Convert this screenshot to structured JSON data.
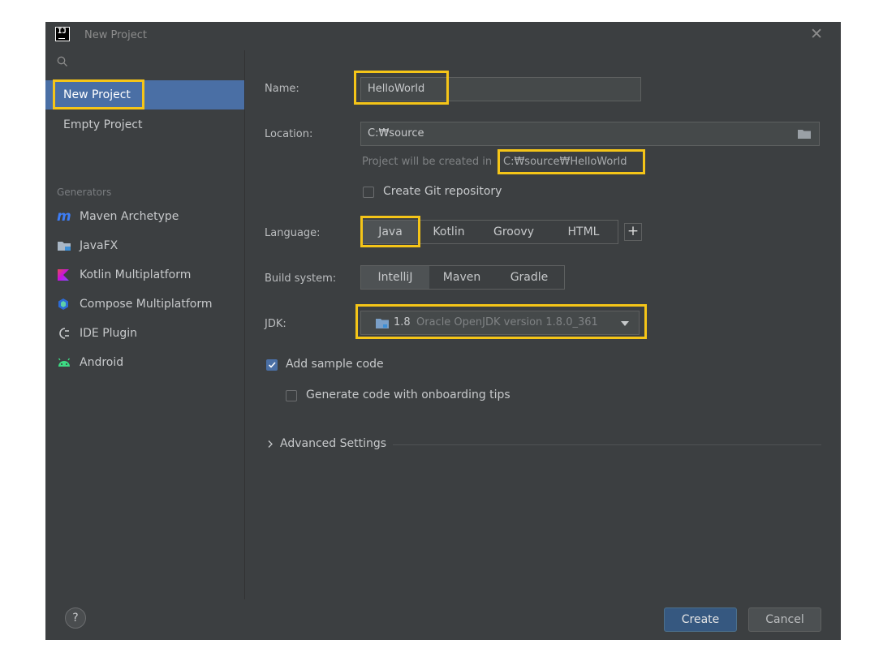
{
  "window": {
    "title": "New Project",
    "logo_text": "IJ"
  },
  "sidebar": {
    "items": [
      {
        "label": "New Project",
        "selected": true
      },
      {
        "label": "Empty Project",
        "selected": false
      }
    ],
    "group_label": "Generators",
    "generators": [
      {
        "label": "Maven Archetype",
        "icon": "maven-icon"
      },
      {
        "label": "JavaFX",
        "icon": "javafx-icon"
      },
      {
        "label": "Kotlin Multiplatform",
        "icon": "kotlin-icon"
      },
      {
        "label": "Compose Multiplatform",
        "icon": "compose-icon"
      },
      {
        "label": "IDE Plugin",
        "icon": "plugin-icon"
      },
      {
        "label": "Android",
        "icon": "android-icon"
      }
    ]
  },
  "form": {
    "name_label": "Name:",
    "name_value": "HelloWorld",
    "location_label": "Location:",
    "location_value": "C:₩source",
    "location_hint_prefix": "Project will be created in",
    "location_hint_path": "C:₩source₩HelloWorld",
    "git_label": "Create Git repository",
    "git_checked": false,
    "language_label": "Language:",
    "languages": [
      "Java",
      "Kotlin",
      "Groovy",
      "HTML"
    ],
    "language_selected": "Java",
    "add_language": "+",
    "build_label": "Build system:",
    "build_systems": [
      "IntelliJ",
      "Maven",
      "Gradle"
    ],
    "build_selected": "IntelliJ",
    "jdk_label": "JDK:",
    "jdk_version": "1.8",
    "jdk_name": "Oracle OpenJDK version 1.8.0_361",
    "sample_label": "Add sample code",
    "sample_checked": true,
    "onboarding_label": "Generate code with onboarding tips",
    "onboarding_checked": false,
    "advanced_label": "Advanced Settings"
  },
  "footer": {
    "help": "?",
    "create_label": "Create",
    "cancel_label": "Cancel"
  },
  "colors": {
    "highlight": "#f5c518",
    "accent": "#4a6fa5",
    "background": "#3c3f41"
  }
}
